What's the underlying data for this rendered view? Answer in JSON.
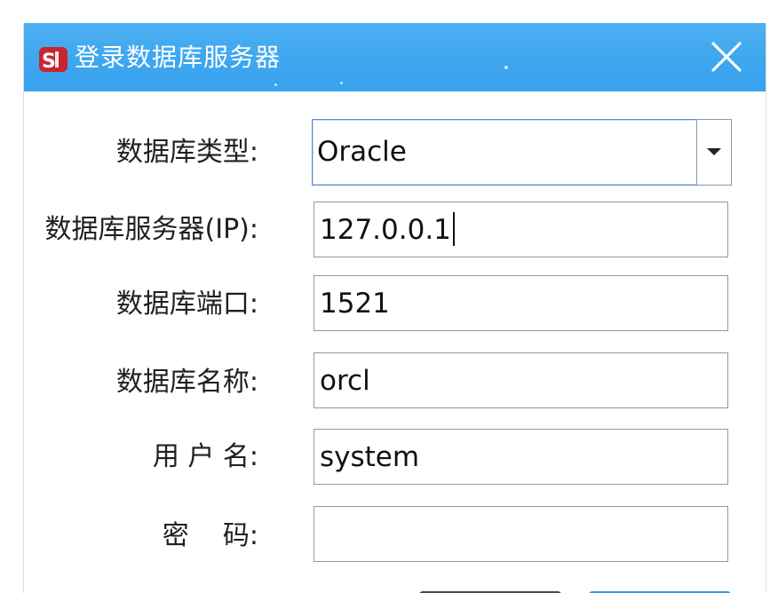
{
  "window": {
    "title": "登录数据库服务器",
    "logo_icon": "app-logo-icon",
    "close_icon": "close-icon",
    "titlebar_color": "#3ea6ef"
  },
  "form": {
    "db_type": {
      "label": "数据库类型:",
      "value": "Oracle",
      "arrow_icon": "chevron-down-icon"
    },
    "db_server": {
      "label": "数据库服务器(IP):",
      "value": "127.0.0.1"
    },
    "db_port": {
      "label": "数据库端口:",
      "value": "1521"
    },
    "db_name": {
      "label": "数据库名称:",
      "value": "orcl"
    },
    "username": {
      "label": "用 户 名:",
      "value": "system"
    },
    "password": {
      "label": "密    码:",
      "value": ""
    }
  }
}
